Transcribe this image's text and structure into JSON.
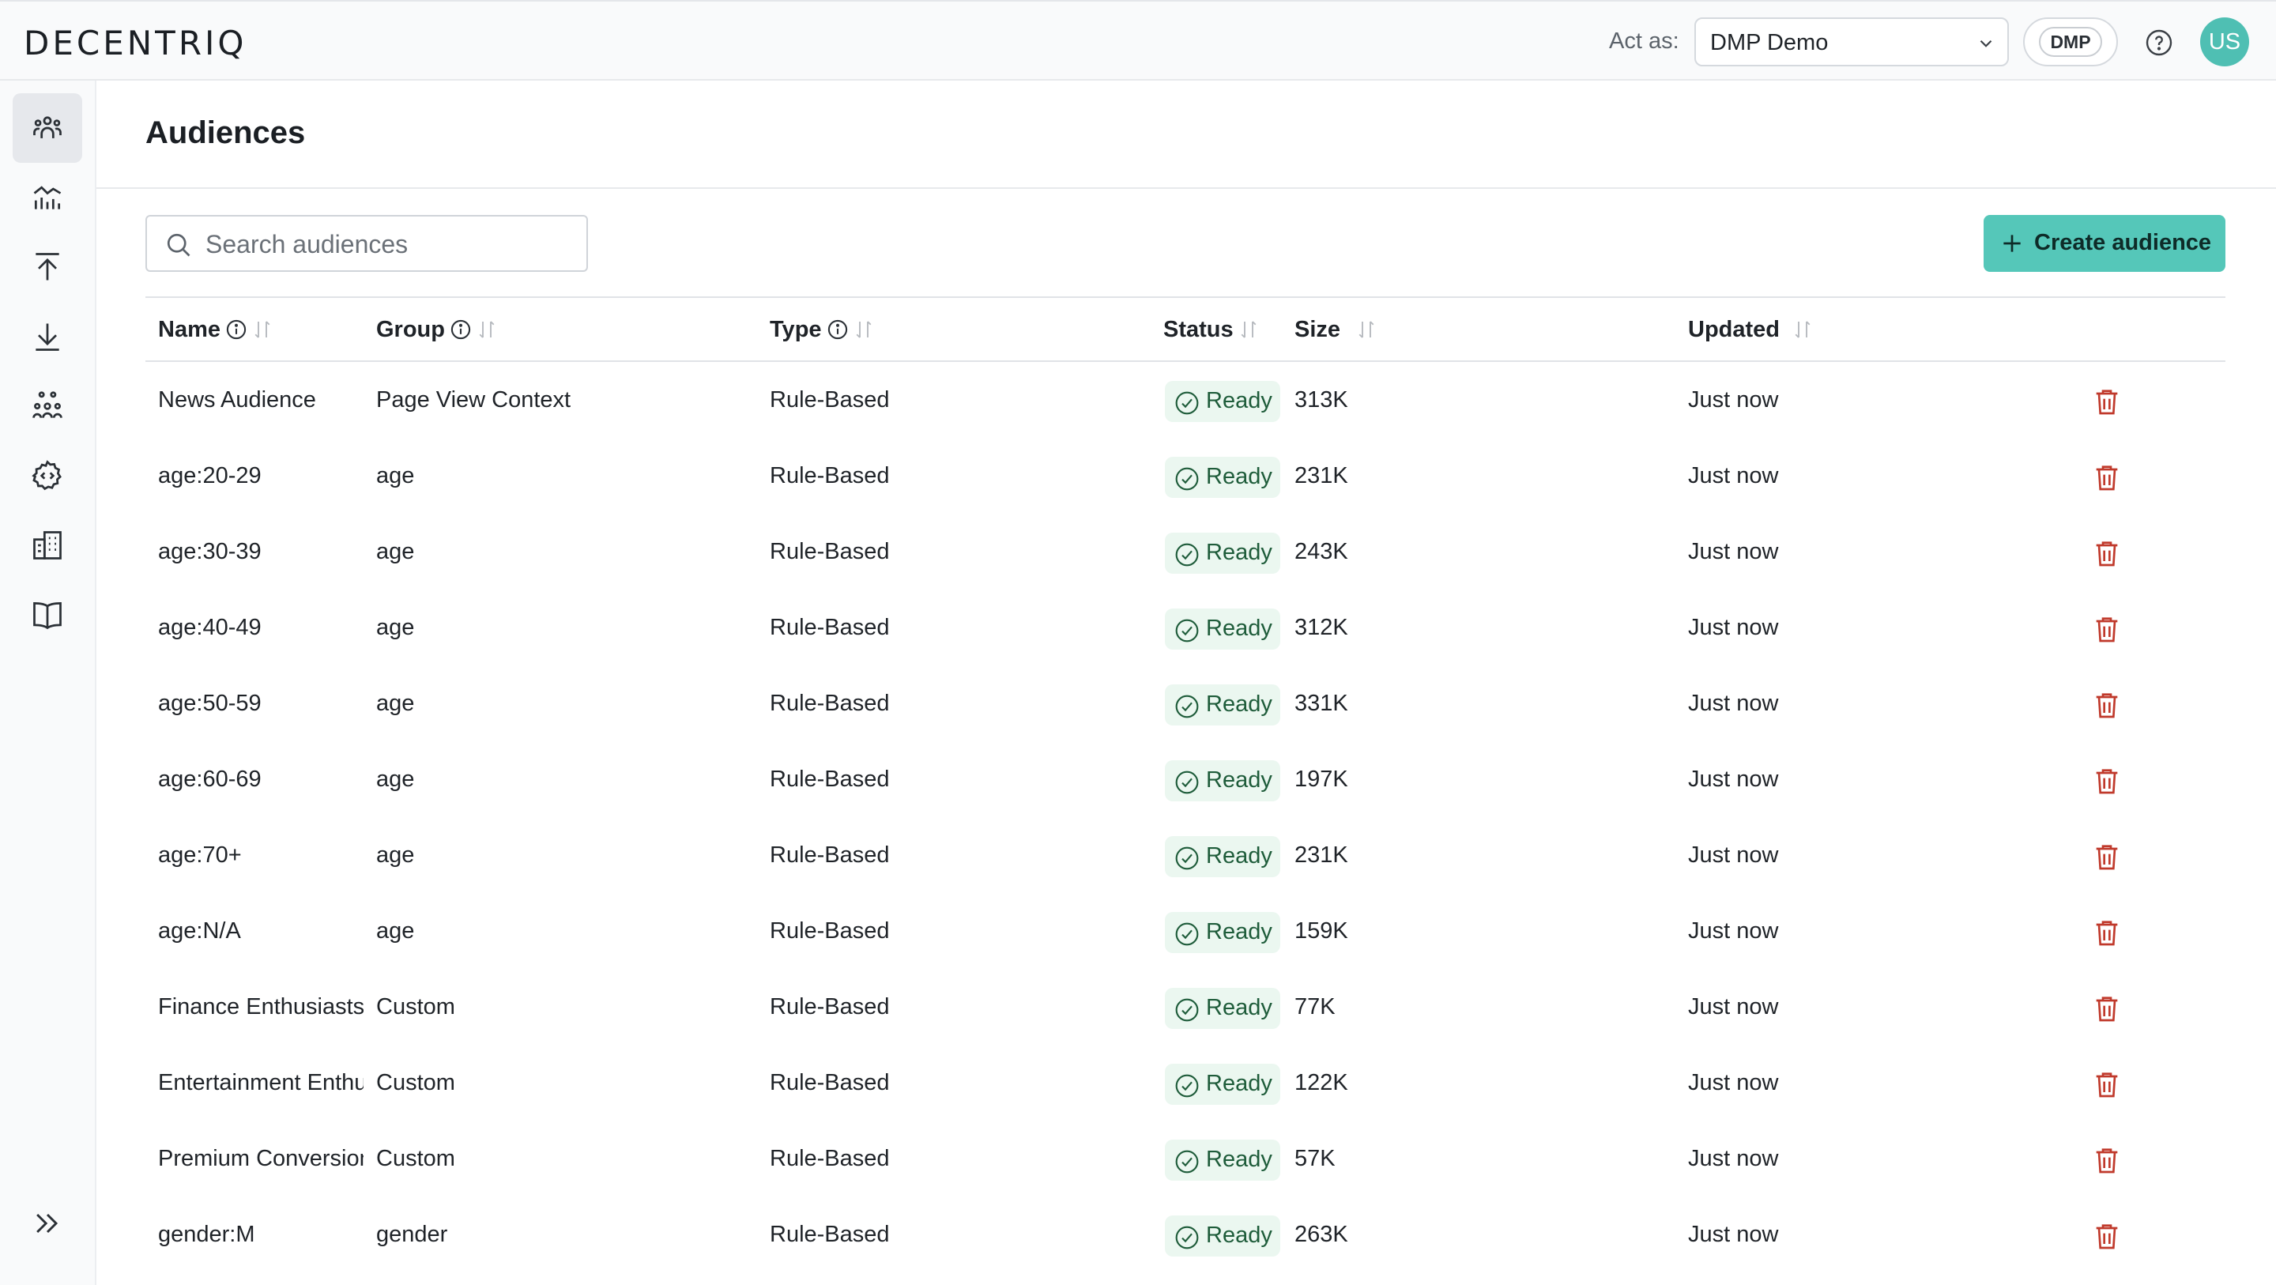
{
  "header": {
    "logo": "DECENTRIQ",
    "act_as_label": "Act as:",
    "org_select_value": "DMP Demo",
    "dmp_badge": "DMP",
    "avatar_initials": "US"
  },
  "sidebar": {
    "items": [
      {
        "icon": "audiences-icon",
        "active": true
      },
      {
        "icon": "insights-chart-icon",
        "active": false
      },
      {
        "icon": "upload-icon",
        "active": false
      },
      {
        "icon": "download-icon",
        "active": false
      },
      {
        "icon": "users-group-icon",
        "active": false
      },
      {
        "icon": "settings-code-icon",
        "active": false
      },
      {
        "icon": "buildings-icon",
        "active": false
      },
      {
        "icon": "book-icon",
        "active": false
      }
    ]
  },
  "page": {
    "title": "Audiences",
    "search_placeholder": "Search audiences",
    "create_button": "Create audience"
  },
  "table": {
    "columns": [
      "Name",
      "Group",
      "Type",
      "Status",
      "Size",
      "Updated"
    ],
    "rows": [
      {
        "name": "News Audience",
        "group": "Page View Context",
        "type": "Rule-Based",
        "status": "Ready",
        "size": "313K",
        "updated": "Just now"
      },
      {
        "name": "age:20-29",
        "group": "age",
        "type": "Rule-Based",
        "status": "Ready",
        "size": "231K",
        "updated": "Just now"
      },
      {
        "name": "age:30-39",
        "group": "age",
        "type": "Rule-Based",
        "status": "Ready",
        "size": "243K",
        "updated": "Just now"
      },
      {
        "name": "age:40-49",
        "group": "age",
        "type": "Rule-Based",
        "status": "Ready",
        "size": "312K",
        "updated": "Just now"
      },
      {
        "name": "age:50-59",
        "group": "age",
        "type": "Rule-Based",
        "status": "Ready",
        "size": "331K",
        "updated": "Just now"
      },
      {
        "name": "age:60-69",
        "group": "age",
        "type": "Rule-Based",
        "status": "Ready",
        "size": "197K",
        "updated": "Just now"
      },
      {
        "name": "age:70+",
        "group": "age",
        "type": "Rule-Based",
        "status": "Ready",
        "size": "231K",
        "updated": "Just now"
      },
      {
        "name": "age:N/A",
        "group": "age",
        "type": "Rule-Based",
        "status": "Ready",
        "size": "159K",
        "updated": "Just now"
      },
      {
        "name": "Finance Enthusiasts",
        "group": "Custom",
        "type": "Rule-Based",
        "status": "Ready",
        "size": "77K",
        "updated": "Just now"
      },
      {
        "name": "Entertainment Enthusiasts",
        "group": "Custom",
        "type": "Rule-Based",
        "status": "Ready",
        "size": "122K",
        "updated": "Just now"
      },
      {
        "name": "Premium Conversion",
        "group": "Custom",
        "type": "Rule-Based",
        "status": "Ready",
        "size": "57K",
        "updated": "Just now"
      },
      {
        "name": "gender:M",
        "group": "gender",
        "type": "Rule-Based",
        "status": "Ready",
        "size": "263K",
        "updated": "Just now"
      }
    ]
  },
  "colors": {
    "accent": "#55c7b9",
    "avatar": "#4fbfb3",
    "status_bg": "#ebf7f0",
    "status_text": "#1e5c3a",
    "delete": "#c0392b"
  }
}
